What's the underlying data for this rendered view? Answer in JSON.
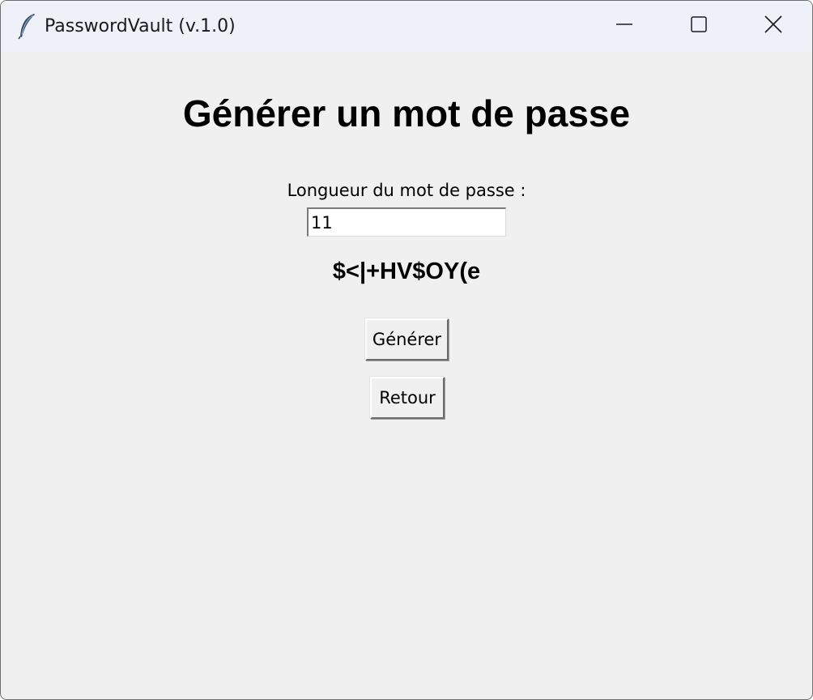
{
  "window": {
    "title": "PasswordVault (v.1.0)",
    "icon": "feather-icon"
  },
  "titlebar_controls": {
    "minimize_icon": "minimize-icon",
    "maximize_icon": "maximize-icon",
    "close_icon": "close-icon"
  },
  "main": {
    "heading": "Générer un mot de passe",
    "length_label": "Longueur du mot de passe :",
    "length_value": "11",
    "generated_password": "$<|+HV$OY(e",
    "generate_button": "Générer",
    "back_button": "Retour"
  }
}
